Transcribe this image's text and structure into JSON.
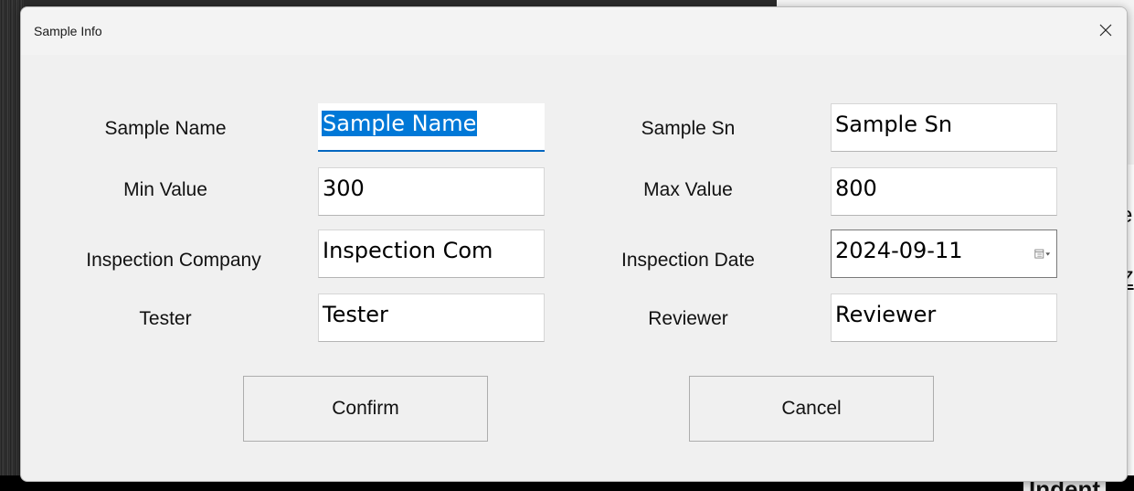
{
  "background": {
    "right_text_1": "e",
    "right_text_2": "Z",
    "bottom_text": "Indent"
  },
  "dialog": {
    "title": "Sample Info",
    "close_icon": "close-icon"
  },
  "form": {
    "sample_name": {
      "label": "Sample Name",
      "value": "Sample Name",
      "focused": true
    },
    "sample_sn": {
      "label": "Sample Sn",
      "value": "Sample Sn"
    },
    "min_value": {
      "label": "Min Value",
      "value": "300"
    },
    "max_value": {
      "label": "Max Value",
      "value": "800"
    },
    "inspection_company": {
      "label": "Inspection Company",
      "value": "Inspection Com"
    },
    "inspection_date": {
      "label": "Inspection Date",
      "value": "2024-09-11",
      "icon": "calendar-dropdown-icon"
    },
    "tester": {
      "label": "Tester",
      "value": "Tester"
    },
    "reviewer": {
      "label": "Reviewer",
      "value": "Reviewer"
    }
  },
  "buttons": {
    "confirm": "Confirm",
    "cancel": "Cancel"
  },
  "colors": {
    "selection": "#0078d7",
    "focus_underline": "#0067c0"
  }
}
